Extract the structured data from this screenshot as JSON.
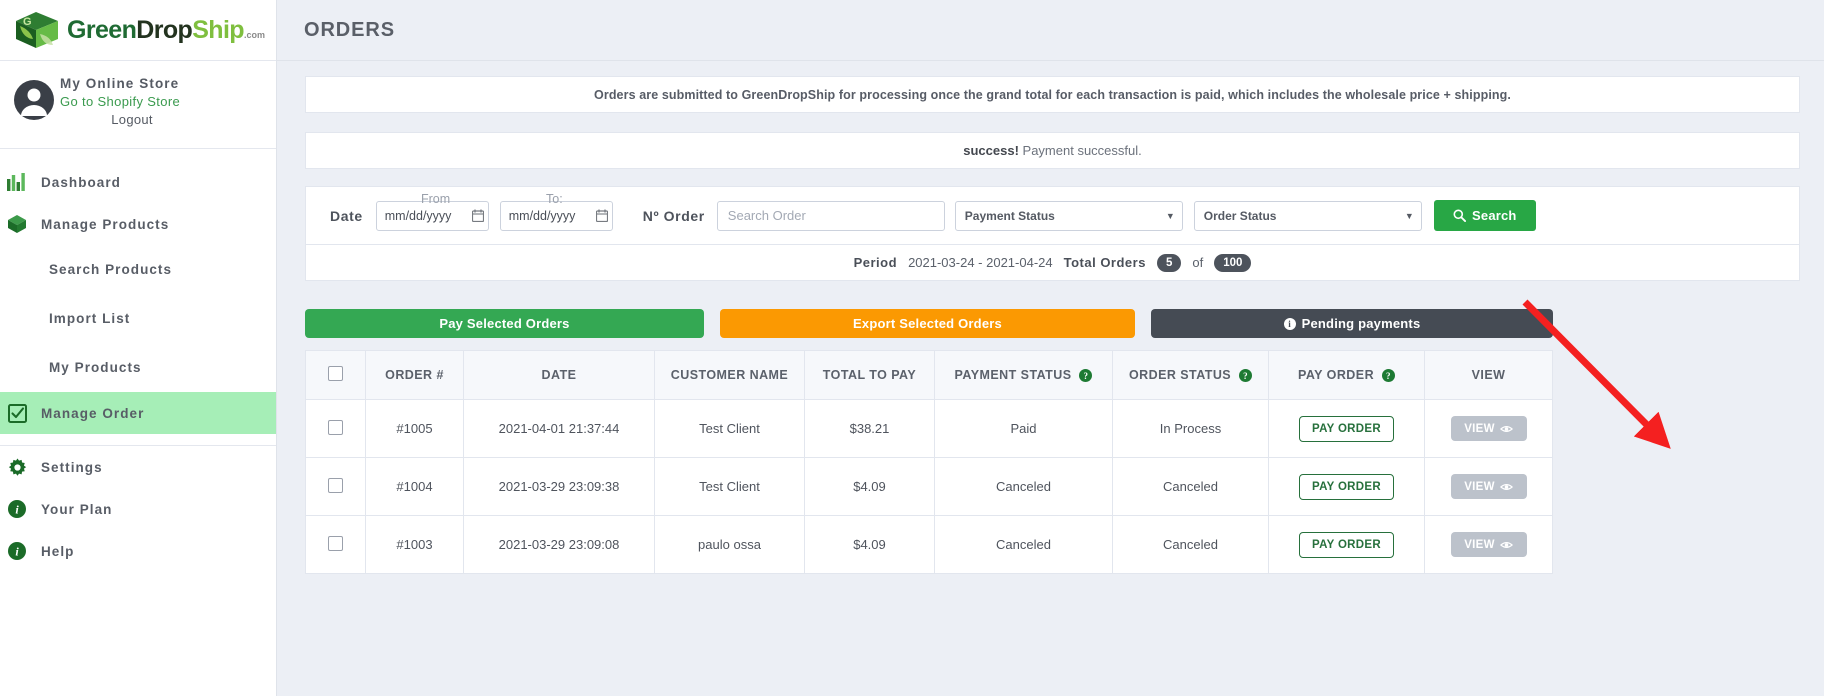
{
  "brand": {
    "name_part1": "Green",
    "name_part2": "Drop",
    "name_part3": "Ship",
    "dotcom": ".com",
    "logo_icon": "green-box-leaf-logo"
  },
  "account": {
    "store_name": "My Online Store",
    "shop_link": "Go to Shopify Store",
    "logout": "Logout",
    "avatar_icon": "user-avatar-icon"
  },
  "sidebar": {
    "items": [
      {
        "label": "Dashboard",
        "icon": "bar-chart-icon",
        "type": "main",
        "active": false
      },
      {
        "label": "Manage Products",
        "icon": "cube-box-icon",
        "type": "main",
        "active": false
      },
      {
        "label": "Search Products",
        "icon": "",
        "type": "sub",
        "active": false
      },
      {
        "label": "Import List",
        "icon": "",
        "type": "sub",
        "active": false
      },
      {
        "label": "My Products",
        "icon": "",
        "type": "sub",
        "active": false
      },
      {
        "label": "Manage Order",
        "icon": "checkbox-check-icon",
        "type": "main",
        "active": true
      },
      {
        "label": "Settings",
        "icon": "gear-icon",
        "type": "main",
        "active": false
      },
      {
        "label": "Your Plan",
        "icon": "info-circle-icon",
        "type": "main",
        "active": false
      },
      {
        "label": "Help",
        "icon": "info-circle-icon",
        "type": "main",
        "active": false
      }
    ]
  },
  "header": {
    "title": "ORDERS"
  },
  "alerts": {
    "info": "Orders are submitted to GreenDropShip for processing once the grand total for each transaction is paid, which includes the wholesale price + shipping.",
    "success_label": "success!",
    "success_text": "Payment successful."
  },
  "filters": {
    "date_label": "Date",
    "from_label": "From",
    "to_label": "To:",
    "date_from_value": "mm/dd/yyyy",
    "date_to_value": "mm/dd/yyyy",
    "calendar_icon": "calendar-icon",
    "norder_label": "Nº Order",
    "search_order_placeholder": "Search Order",
    "payment_status_selected": "Payment Status",
    "order_status_selected": "Order Status",
    "chevron_icon": "chevron-down-icon",
    "search_button": "Search",
    "search_icon": "magnifier-icon"
  },
  "summary": {
    "period_label": "Period",
    "period_value": "2021-03-24 - 2021-04-24",
    "total_label": "Total Orders",
    "total_shown": "5",
    "of_label": "of",
    "total_all": "100"
  },
  "actions": {
    "pay_selected": "Pay Selected Orders",
    "export_selected": "Export Selected Orders",
    "pending_payments": "Pending payments",
    "pending_icon": "info-circle-icon"
  },
  "table": {
    "columns": [
      {
        "label": "",
        "name": "select-all"
      },
      {
        "label": "ORDER #",
        "name": "order-number"
      },
      {
        "label": "DATE",
        "name": "date"
      },
      {
        "label": "CUSTOMER NAME",
        "name": "customer-name"
      },
      {
        "label": "TOTAL TO PAY",
        "name": "total-to-pay"
      },
      {
        "label": "PAYMENT STATUS",
        "name": "payment-status",
        "help": true
      },
      {
        "label": "ORDER STATUS",
        "name": "order-status",
        "help": true
      },
      {
        "label": "PAY ORDER",
        "name": "pay-order",
        "help": true
      },
      {
        "label": "VIEW",
        "name": "view"
      }
    ],
    "help_icon": "question-mark-icon",
    "pay_order_button": "PAY ORDER",
    "view_button": "VIEW",
    "eye_icon": "eye-icon",
    "rows": [
      {
        "order": "#1005",
        "date": "2021-04-01 21:37:44",
        "customer": "Test Client",
        "total": "$38.21",
        "payment_status": "Paid",
        "order_status": "In Process"
      },
      {
        "order": "#1004",
        "date": "2021-03-29 23:09:38",
        "customer": "Test Client",
        "total": "$4.09",
        "payment_status": "Canceled",
        "order_status": "Canceled"
      },
      {
        "order": "#1003",
        "date": "2021-03-29 23:09:08",
        "customer": "paulo ossa",
        "total": "$4.09",
        "payment_status": "Canceled",
        "order_status": "Canceled"
      }
    ]
  },
  "annotation": {
    "arrow_color": "#f42020",
    "arrow_icon": "red-pointer-arrow"
  },
  "colors": {
    "accent_green": "#28a745",
    "orange": "#fb9902",
    "dark": "#454b54",
    "active_nav": "#a6eeb7"
  }
}
